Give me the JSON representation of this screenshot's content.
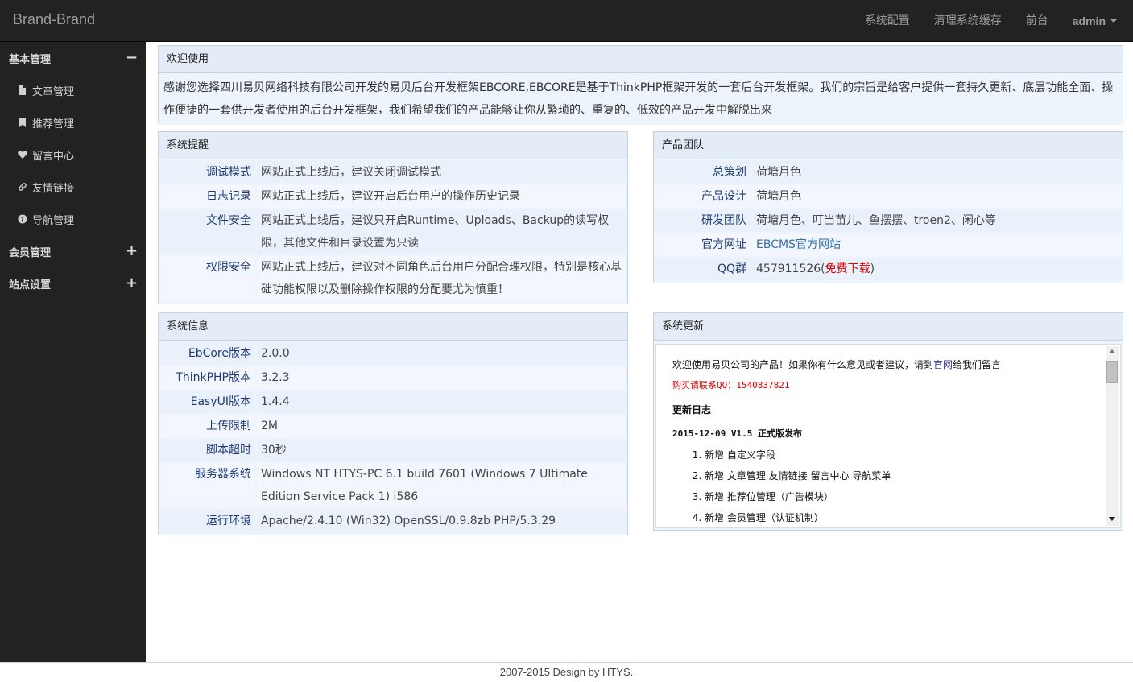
{
  "navbar": {
    "brand": "Brand-Brand",
    "links": [
      "系统配置",
      "清理系统缓存",
      "前台"
    ],
    "user": "admin"
  },
  "sidebar": {
    "groups": [
      {
        "label": "基本管理",
        "toggle": "−",
        "expanded": true,
        "items": [
          {
            "label": "文章管理",
            "icon": "file-icon"
          },
          {
            "label": "推荐管理",
            "icon": "bookmark-icon"
          },
          {
            "label": "留言中心",
            "icon": "heart-icon"
          },
          {
            "label": "友情链接",
            "icon": "link-icon"
          },
          {
            "label": "导航管理",
            "icon": "globe-icon"
          }
        ]
      },
      {
        "label": "会员管理",
        "toggle": "+",
        "expanded": false
      },
      {
        "label": "站点设置",
        "toggle": "+",
        "expanded": false
      }
    ]
  },
  "welcome": {
    "title": "欢迎使用",
    "text": "感谢您选择四川易贝网络科技有限公司开发的易贝后台开发框架EBCORE,EBCORE是基于ThinkPHP框架开发的一套后台开发框架。我们的宗旨是给客户提供一套持久更新、底层功能全面、操作便捷的一套供开发者使用的后台开发框架，我们希望我们的产品能够让你从繁琐的、重复的、低效的产品开发中解脱出来"
  },
  "reminders": {
    "title": "系统提醒",
    "rows": [
      {
        "key": "调试模式",
        "value": "网站正式上线后，建议关闭调试模式"
      },
      {
        "key": "日志记录",
        "value": "网站正式上线后，建议开启后台用户的操作历史记录"
      },
      {
        "key": "文件安全",
        "value": "网站正式上线后，建议只开启Runtime、Uploads、Backup的读写权限，其他文件和目录设置为只读"
      },
      {
        "key": "权限安全",
        "value": "网站正式上线后，建议对不同角色后台用户分配合理权限，特别是核心基础功能权限以及删除操作权限的分配要尤为慎重！"
      }
    ]
  },
  "team": {
    "title": "产品团队",
    "rows": [
      {
        "key": "总策划",
        "value": "荷塘月色"
      },
      {
        "key": "产品设计",
        "value": "荷塘月色"
      },
      {
        "key": "研发团队",
        "value": "荷塘月色、叮当苗儿、鱼摆摆、troen2、闲心等"
      },
      {
        "key": "官方网址",
        "value": "EBCMS官方网站"
      },
      {
        "key": "QQ群",
        "value": "457911526",
        "paren_open": "(",
        "extra": "免费下载",
        "paren_close": ")"
      }
    ]
  },
  "sysinfo": {
    "title": "系统信息",
    "rows": [
      {
        "key": "EbCore版本",
        "value": "2.0.0"
      },
      {
        "key": "ThinkPHP版本",
        "value": "3.2.3"
      },
      {
        "key": "EasyUI版本",
        "value": "1.4.4"
      },
      {
        "key": "上传限制",
        "value": "2M"
      },
      {
        "key": "脚本超时",
        "value": "30秒"
      },
      {
        "key": "服务器系统",
        "value": "Windows NT HTYS-PC 6.1 build 7601 (Windows 7 Ultimate Edition Service Pack 1) i586"
      },
      {
        "key": "运行环境",
        "value": "Apache/2.4.10 (Win32) OpenSSL/0.9.8zb PHP/5.3.29"
      }
    ]
  },
  "updates": {
    "title": "系统更新",
    "intro_pre": "欢迎使用易贝公司的产品！如果你有什么意见或者建议，请到",
    "intro_link": "官网",
    "intro_post": "给我们留言",
    "contact": "购买请联系QQ：1540837821",
    "log_title": "更新日志",
    "release": "2015-12-09 V1.5 正式版发布",
    "items": [
      "新增 自定义字段",
      "新增 文章管理 友情链接 留言中心 导航菜单",
      "新增 推荐位管理（广告模块）",
      "新增 会员管理（认证机制）"
    ]
  },
  "footer": {
    "text": "2007-2015 Design by HTYS."
  }
}
